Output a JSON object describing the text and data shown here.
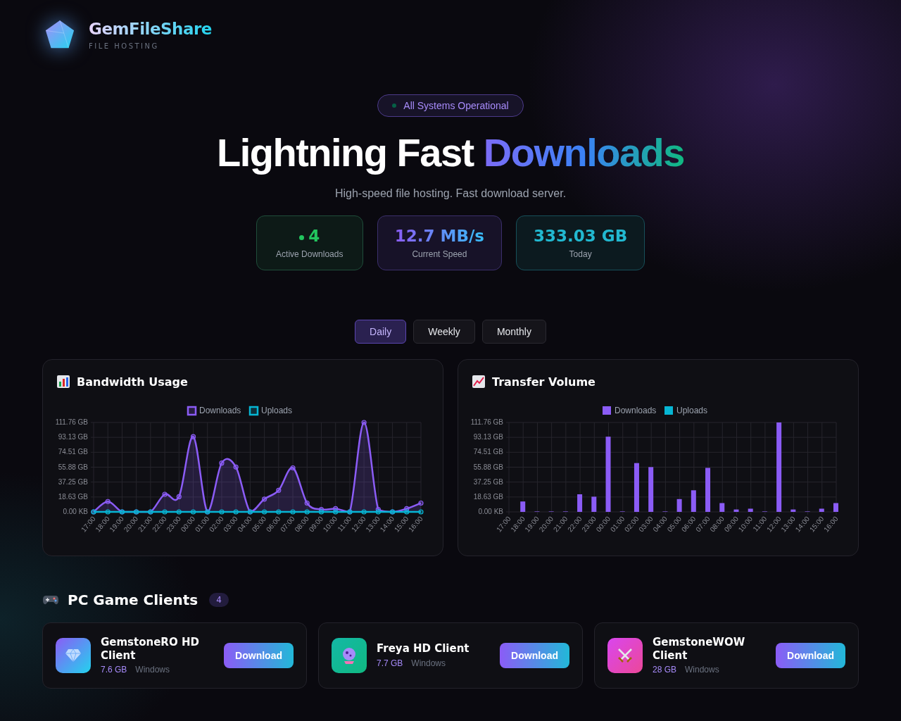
{
  "brand": {
    "name": "GemFileShare",
    "tagline": "FILE HOSTING"
  },
  "status": {
    "label": "All Systems Operational",
    "operational": true
  },
  "hero": {
    "title_start": "Lightning Fast",
    "title_highlight": "Downloads",
    "subtitle": "High-speed file hosting. Fast download server."
  },
  "stats": [
    {
      "kind": "active",
      "value": "4",
      "label": "Active Downloads"
    },
    {
      "kind": "speed",
      "value": "12.7 MB/s",
      "label": "Current Speed"
    },
    {
      "kind": "total",
      "value": "333.03 GB",
      "label": "Today"
    }
  ],
  "period_tabs": [
    {
      "label": "Daily",
      "selected": true
    },
    {
      "label": "Weekly",
      "selected": false
    },
    {
      "label": "Monthly",
      "selected": false
    }
  ],
  "charts": [
    {
      "title": "Bandwidth Usage",
      "chart_data": {
        "type": "area",
        "grid": true,
        "legend": "top",
        "categories": [
          "17:00",
          "18:00",
          "19:00",
          "20:00",
          "21:00",
          "22:00",
          "23:00",
          "00:00",
          "01:00",
          "02:00",
          "03:00",
          "04:00",
          "05:00",
          "06:00",
          "07:00",
          "08:00",
          "09:00",
          "10:00",
          "11:00",
          "12:00",
          "13:00",
          "14:00",
          "15:00",
          "16:00"
        ],
        "series": [
          {
            "name": "Downloads",
            "color": "#8b5cf6",
            "values": [
              0,
              13,
              0,
              0,
              0,
              22,
              19,
              94,
              0,
              61,
              56,
              0,
              16,
              27,
              55,
              11,
              3,
              4,
              0,
              111.76,
              3,
              0,
              4,
              11
            ]
          },
          {
            "name": "Uploads",
            "color": "#06b6d4",
            "values": [
              0,
              0,
              0,
              0,
              0,
              0,
              0,
              0,
              0,
              0,
              0,
              0,
              0,
              0,
              0,
              0,
              0,
              0,
              0,
              0,
              0,
              0,
              0,
              0
            ]
          }
        ],
        "ylim": [
          0,
          111.76
        ],
        "yticks": [
          {
            "value": 0,
            "label": "0.00 KB"
          },
          {
            "value": 18.63,
            "label": "18.63 GB"
          },
          {
            "value": 37.25,
            "label": "37.25 GB"
          },
          {
            "value": 55.88,
            "label": "55.88 GB"
          },
          {
            "value": 74.51,
            "label": "74.51 GB"
          },
          {
            "value": 93.13,
            "label": "93.13 GB"
          },
          {
            "value": 111.76,
            "label": "111.76 GB"
          }
        ]
      }
    },
    {
      "title": "Transfer Volume",
      "chart_data": {
        "type": "bar",
        "grid": true,
        "legend": "top",
        "categories": [
          "17:00",
          "18:00",
          "19:00",
          "20:00",
          "21:00",
          "22:00",
          "23:00",
          "00:00",
          "01:00",
          "02:00",
          "03:00",
          "04:00",
          "05:00",
          "06:00",
          "07:00",
          "08:00",
          "09:00",
          "10:00",
          "11:00",
          "12:00",
          "13:00",
          "14:00",
          "15:00",
          "16:00"
        ],
        "series": [
          {
            "name": "Downloads",
            "color": "#8b5cf6",
            "values": [
              0,
              13,
              0,
              0,
              0,
              22,
              19,
              94,
              0,
              61,
              56,
              0,
              16,
              27,
              55,
              11,
              3,
              4,
              0,
              111.76,
              3,
              0,
              4,
              11
            ]
          },
          {
            "name": "Uploads",
            "color": "#06b6d4",
            "values": [
              0,
              0,
              0,
              0,
              0,
              0,
              0,
              0,
              0,
              0,
              0,
              0,
              0,
              0,
              0,
              0,
              0,
              0,
              0,
              0,
              0,
              0,
              0,
              0
            ]
          }
        ],
        "ylim": [
          0,
          111.76
        ],
        "yticks": [
          {
            "value": 0,
            "label": "0.00 KB"
          },
          {
            "value": 18.63,
            "label": "18.63 GB"
          },
          {
            "value": 37.25,
            "label": "37.25 GB"
          },
          {
            "value": 55.88,
            "label": "55.88 GB"
          },
          {
            "value": 74.51,
            "label": "74.51 GB"
          },
          {
            "value": 93.13,
            "label": "93.13 GB"
          },
          {
            "value": 111.76,
            "label": "111.76 GB"
          }
        ]
      }
    }
  ],
  "section": {
    "title": "PC Game Clients",
    "count": "4"
  },
  "clients": [
    {
      "kind": "gem",
      "name": "GemstoneRO HD Client",
      "size": "7.6 GB",
      "platform": "Windows",
      "button": "Download"
    },
    {
      "kind": "orb",
      "name": "Freya HD Client",
      "size": "7.7 GB",
      "platform": "Windows",
      "button": "Download"
    },
    {
      "kind": "swords",
      "name": "GemstoneWOW Client",
      "size": "28 GB",
      "platform": "Windows",
      "button": "Download"
    }
  ]
}
